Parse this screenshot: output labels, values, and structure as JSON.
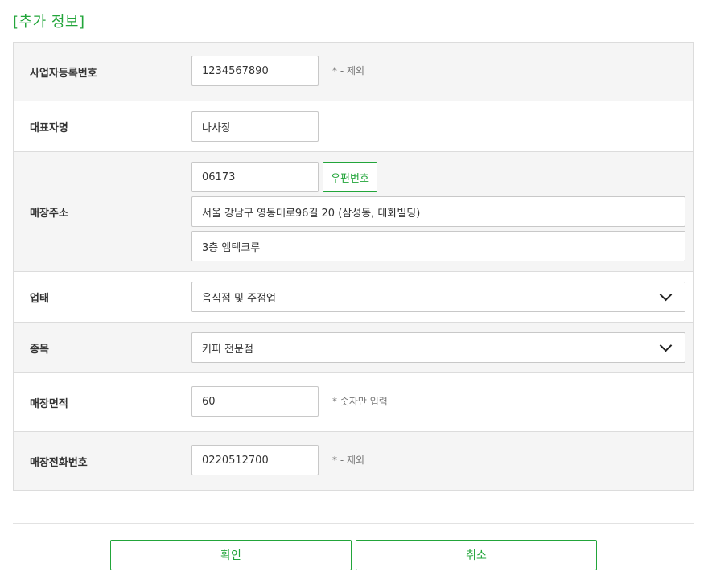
{
  "section": {
    "title": "[추가 정보]"
  },
  "form": {
    "business_number": {
      "label": "사업자등록번호",
      "value": "1234567890",
      "hint": "* - 제외"
    },
    "representative": {
      "label": "대표자명",
      "value": "나사장"
    },
    "store_address": {
      "label": "매장주소",
      "zipcode": "06173",
      "zip_button": "우편번호",
      "address1": "서울 강남구 영동대로96길 20 (삼성동, 대화빌딩)",
      "address2": "3층 엠텍크루"
    },
    "business_type": {
      "label": "업태",
      "selected": "음식점 및 주점업"
    },
    "business_item": {
      "label": "종목",
      "selected": "커피 전문점"
    },
    "store_area": {
      "label": "매장면적",
      "value": "60",
      "hint": "* 숫자만 입력"
    },
    "store_phone": {
      "label": "매장전화번호",
      "value": "0220512700",
      "hint": "* - 제외"
    }
  },
  "actions": {
    "confirm": "확인",
    "cancel": "취소"
  },
  "colors": {
    "accent": "#22a53a",
    "row_alt_bg": "#f5f5f5",
    "border": "#dcdcdc"
  },
  "icons": {
    "select_arrow": "chevron-down-icon"
  }
}
